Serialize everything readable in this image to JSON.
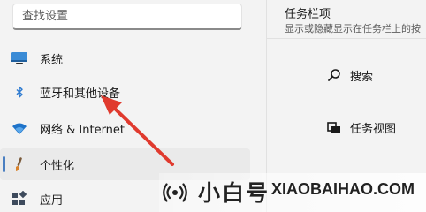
{
  "search": {
    "placeholder": "查找设置"
  },
  "sidebar": {
    "items": [
      {
        "label": "系统",
        "icon": "system-display-icon"
      },
      {
        "label": "蓝牙和其他设备",
        "icon": "bluetooth-icon"
      },
      {
        "label": "网络 & Internet",
        "icon": "wifi-icon"
      },
      {
        "label": "个性化",
        "icon": "paintbrush-icon",
        "selected": true
      },
      {
        "label": "应用",
        "icon": "apps-icon"
      }
    ]
  },
  "taskbar_panel": {
    "title": "任务栏项",
    "subtitle": "显示或隐藏显示在任务栏上的按",
    "items": [
      {
        "label": "搜索",
        "icon": "search-icon"
      },
      {
        "label": "任务视图",
        "icon": "task-view-icon"
      }
    ]
  },
  "watermark": {
    "name": "小白号",
    "site": "XIAOBAIHAO.COM"
  },
  "colors": {
    "background": "#f3f3f3",
    "accent": "#4a7fc1",
    "arrow": "#e03a2e"
  }
}
